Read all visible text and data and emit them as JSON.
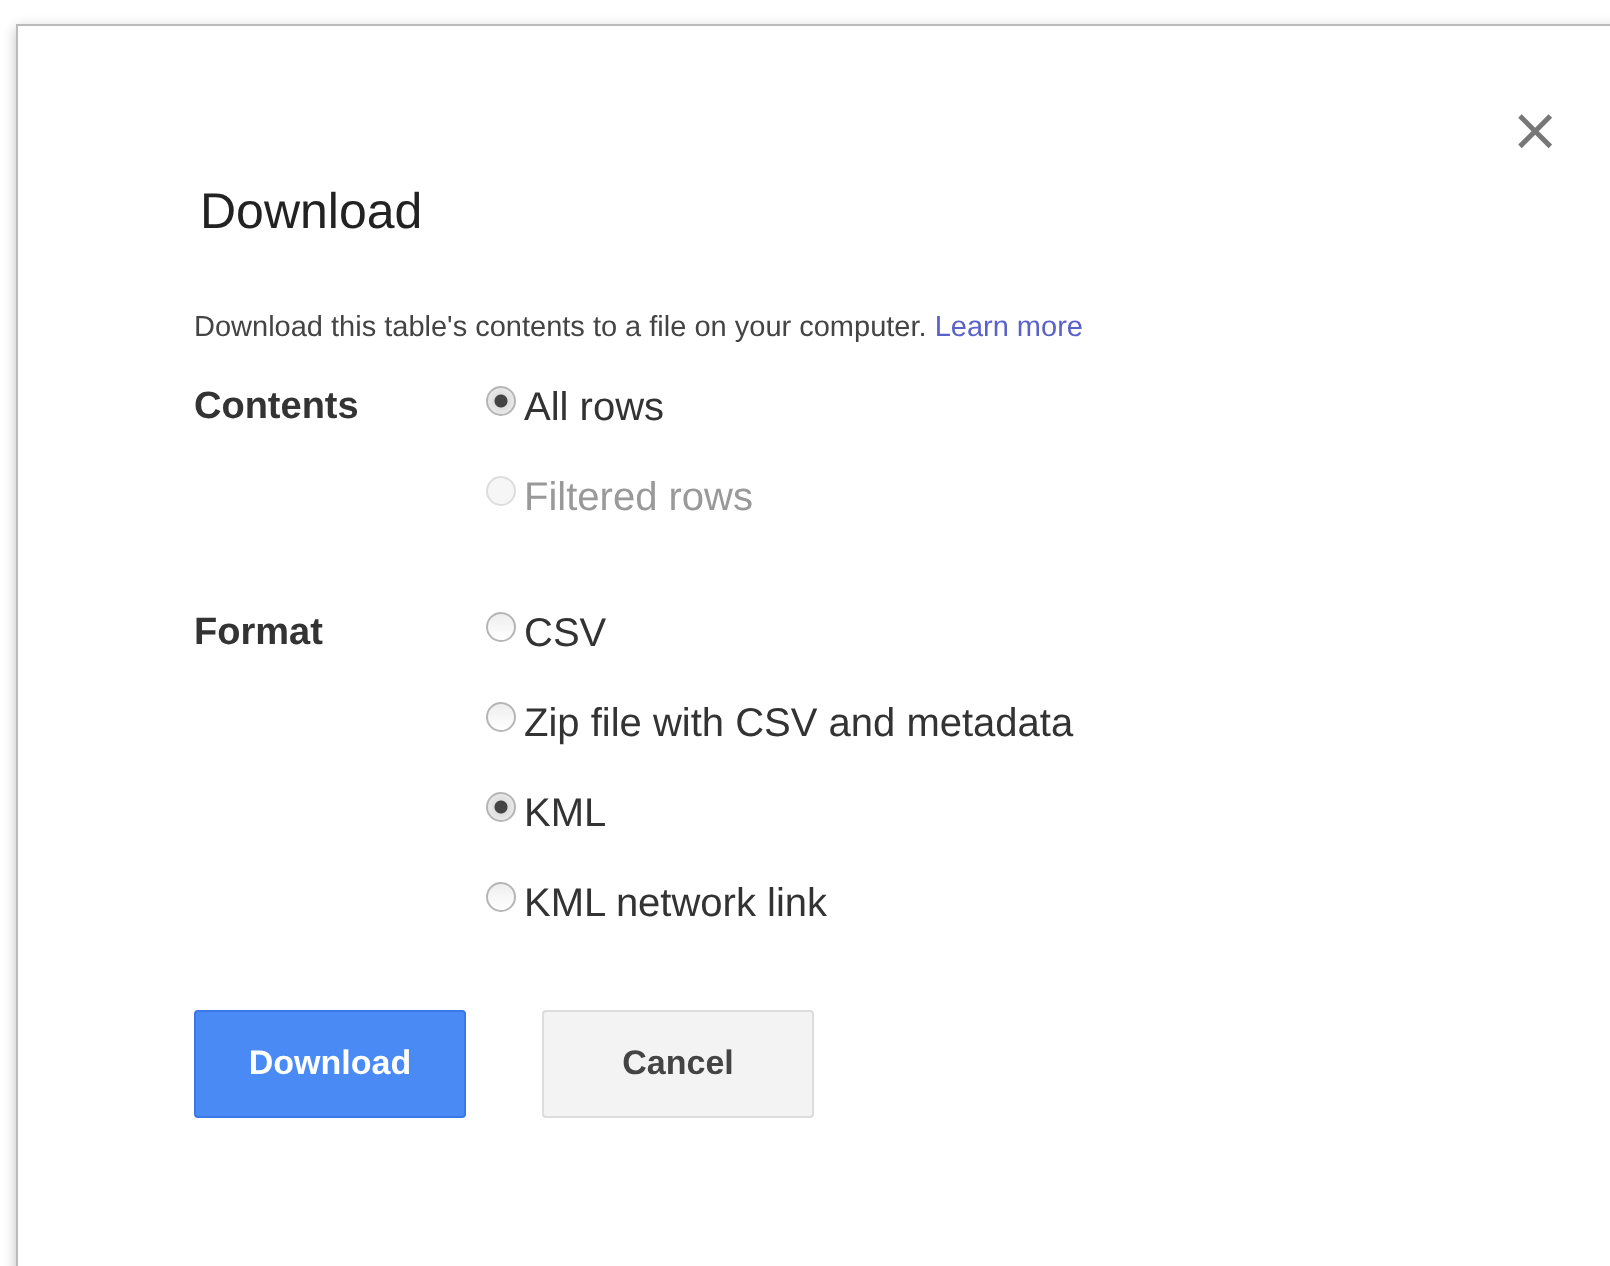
{
  "dialog": {
    "title": "Download",
    "close": "×",
    "description": "Download this table's contents to a file on your computer.",
    "learn_more": "Learn more",
    "groups": [
      {
        "label": "Contents",
        "options": [
          {
            "label": "All rows",
            "selected": true,
            "disabled": false
          },
          {
            "label": "Filtered rows",
            "selected": false,
            "disabled": true
          }
        ]
      },
      {
        "label": "Format",
        "options": [
          {
            "label": "CSV",
            "selected": false,
            "disabled": false
          },
          {
            "label": "Zip file with CSV and metadata",
            "selected": false,
            "disabled": false
          },
          {
            "label": "KML",
            "selected": true,
            "disabled": false
          },
          {
            "label": "KML network link",
            "selected": false,
            "disabled": false
          }
        ]
      }
    ],
    "buttons": [
      {
        "label": "Download",
        "kind": "primary"
      },
      {
        "label": "Cancel",
        "kind": "secondary"
      }
    ]
  }
}
